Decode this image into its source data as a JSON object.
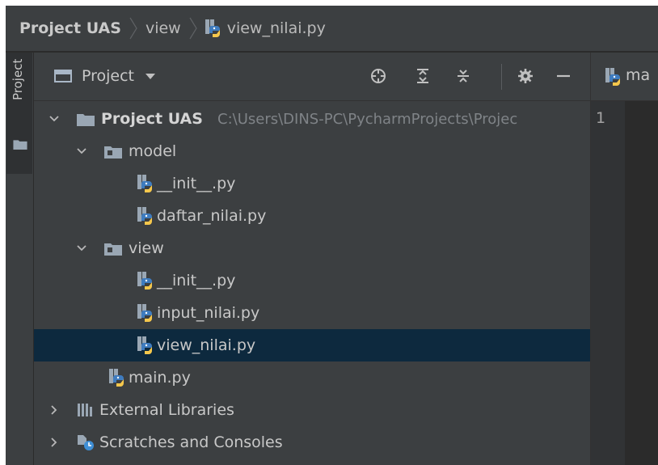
{
  "navbar": {
    "crumbs": [
      "Project UAS",
      "view",
      "view_nilai.py"
    ]
  },
  "stripe": {
    "label": "Project"
  },
  "toolbar": {
    "view_label": "Project"
  },
  "tree": {
    "root": {
      "label": "Project UAS",
      "path": "C:\\Users\\DINS-PC\\PycharmProjects\\Projec"
    },
    "model": {
      "label": "model",
      "files": [
        "__init__.py",
        "daftar_nilai.py"
      ]
    },
    "view": {
      "label": "view",
      "files": [
        "__init__.py",
        "input_nilai.py",
        "view_nilai.py"
      ]
    },
    "main": "main.py",
    "external": "External Libraries",
    "scratches": "Scratches and Consoles"
  },
  "editor": {
    "tab_label": "ma",
    "line_number": "1"
  },
  "colors": {
    "selection": "#0d293e",
    "python_blue": "#3f7cbf",
    "python_yellow": "#f5c74c",
    "background": "#3c3f41"
  }
}
